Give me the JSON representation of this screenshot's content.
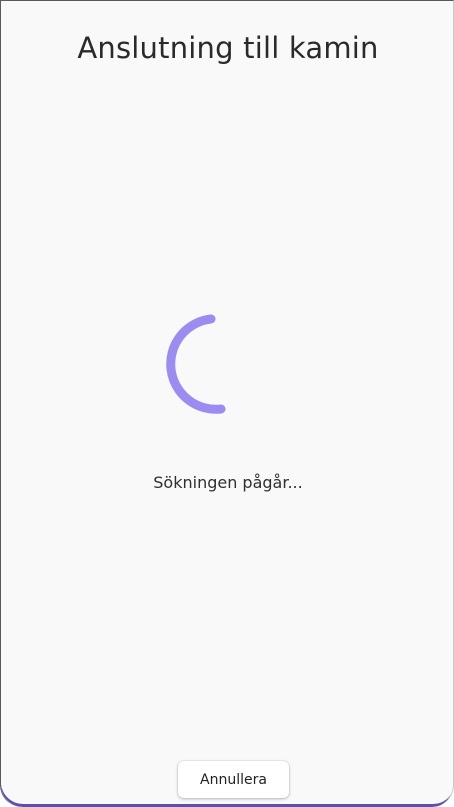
{
  "header": {
    "title": "Anslutning till kamin"
  },
  "main": {
    "status_text": "Sökningen pågår...",
    "spinner_icon": "loading-spinner-icon"
  },
  "footer": {
    "cancel_label": "Annullera"
  },
  "colors": {
    "accent": "#9b8cf2",
    "background": "#f9f9f9",
    "frame_accent": "#5b4fb0"
  }
}
